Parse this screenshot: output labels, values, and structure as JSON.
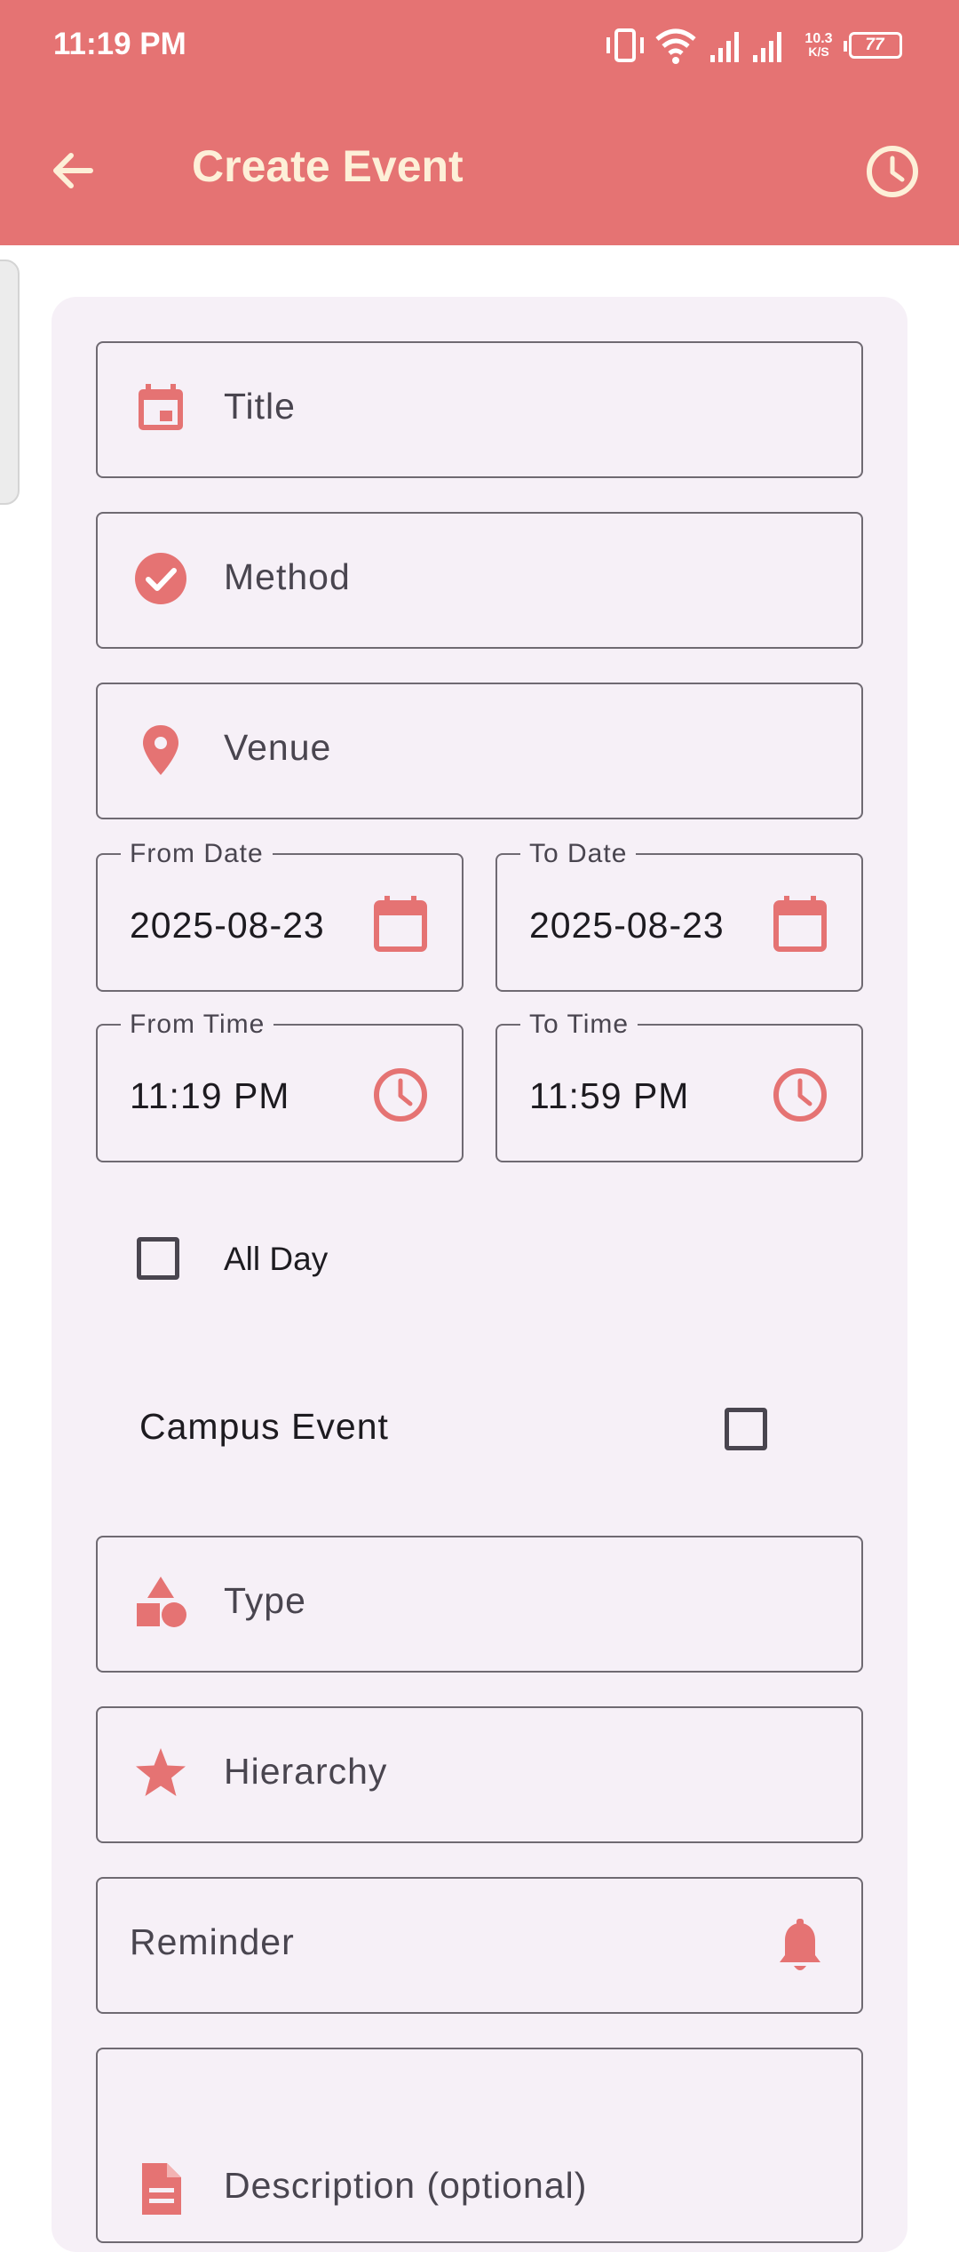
{
  "status_bar": {
    "time": "11:19 PM",
    "net_speed_top": "10.3",
    "net_speed_bottom": "K/S",
    "battery": "77"
  },
  "app_bar": {
    "title": "Create Event",
    "back_icon": "arrow-left-icon",
    "history_icon": "clock-icon"
  },
  "form": {
    "title_label": "Title",
    "method_label": "Method",
    "venue_label": "Venue",
    "from_date": {
      "legend": "From Date",
      "value": "2025-08-23"
    },
    "to_date": {
      "legend": "To Date",
      "value": "2025-08-23"
    },
    "from_time": {
      "legend": "From Time",
      "value": "11:19 PM"
    },
    "to_time": {
      "legend": "To Time",
      "value": "11:59 PM"
    },
    "all_day": {
      "label": "All Day",
      "checked": false
    },
    "campus_event": {
      "label": "Campus Event",
      "checked": false
    },
    "type_label": "Type",
    "hierarchy_label": "Hierarchy",
    "reminder_label": "Reminder",
    "description_label": "Description (optional)"
  },
  "colors": {
    "primary": "#e57373",
    "title_text": "#fdf0d8",
    "card_bg": "#f6f0f7",
    "outline": "#6f6a72"
  }
}
